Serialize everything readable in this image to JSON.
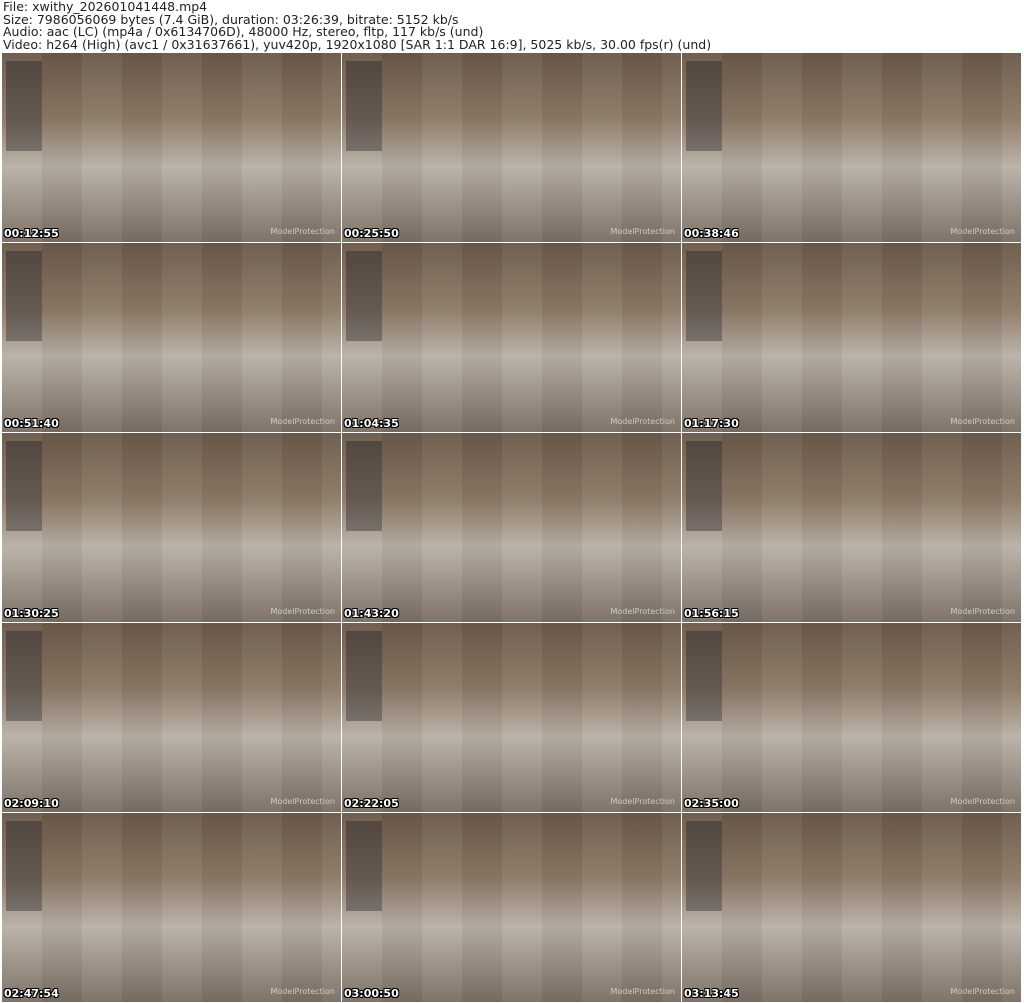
{
  "header": {
    "file": "File: xwithy_202601041448.mp4",
    "size": "Size: 7986056069 bytes (7.4 GiB), duration: 03:26:39, bitrate: 5152 kb/s",
    "audio": "Audio: aac (LC) (mp4a / 0x6134706D), 48000 Hz, stereo, fltp, 117 kb/s (und)",
    "video": "Video: h264 (High) (avc1 / 0x31637661), yuv420p, 1920x1080 [SAR 1:1 DAR 16:9], 5025 kb/s, 30.00 fps(r) (und)"
  },
  "watermark": "ModelProtection",
  "thumbnails": [
    {
      "timestamp": "00:12:55"
    },
    {
      "timestamp": "00:25:50"
    },
    {
      "timestamp": "00:38:46"
    },
    {
      "timestamp": "00:51:40"
    },
    {
      "timestamp": "01:04:35"
    },
    {
      "timestamp": "01:17:30"
    },
    {
      "timestamp": "01:30:25"
    },
    {
      "timestamp": "01:43:20"
    },
    {
      "timestamp": "01:56:15"
    },
    {
      "timestamp": "02:09:10"
    },
    {
      "timestamp": "02:22:05"
    },
    {
      "timestamp": "02:35:00"
    },
    {
      "timestamp": "02:47:54"
    },
    {
      "timestamp": "03:00:50"
    },
    {
      "timestamp": "03:13:45"
    }
  ]
}
